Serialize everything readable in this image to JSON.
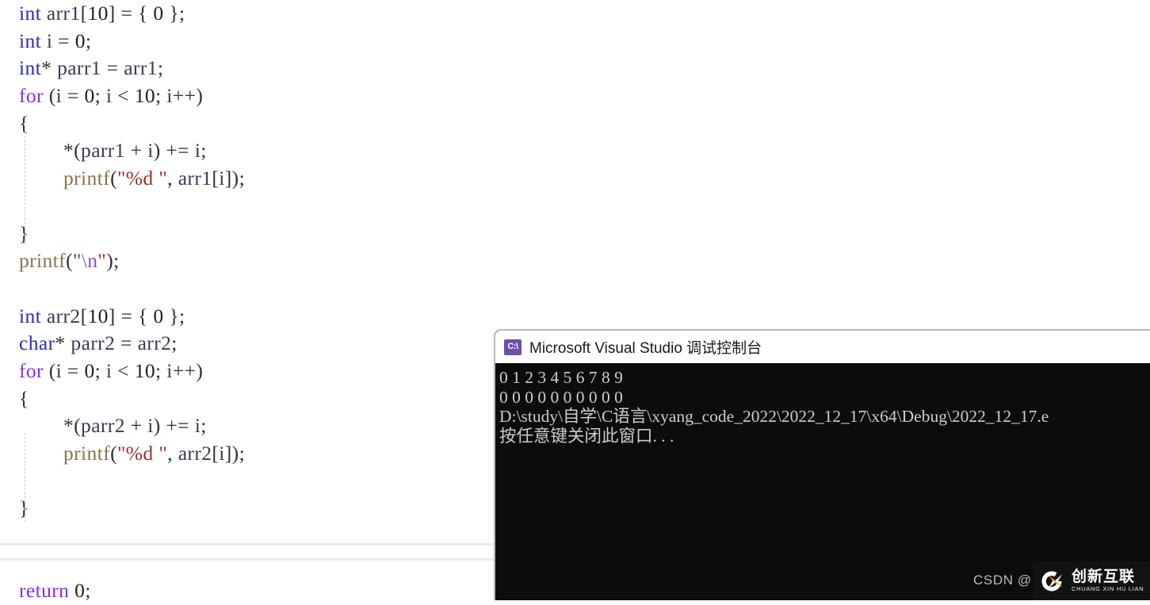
{
  "editor": {
    "lines": [
      {
        "id": 1,
        "indent": 0,
        "tokens": [
          {
            "t": "int",
            "c": "kw-type"
          },
          {
            "t": " ",
            "c": "plain"
          },
          {
            "t": "arr1",
            "c": "ident"
          },
          {
            "t": "[",
            "c": "punct"
          },
          {
            "t": "10",
            "c": "num"
          },
          {
            "t": "] = { ",
            "c": "punct"
          },
          {
            "t": "0",
            "c": "num"
          },
          {
            "t": " };",
            "c": "punct"
          }
        ]
      },
      {
        "id": 2,
        "indent": 0,
        "tokens": [
          {
            "t": "int",
            "c": "kw-type"
          },
          {
            "t": " ",
            "c": "plain"
          },
          {
            "t": "i",
            "c": "ident"
          },
          {
            "t": " = ",
            "c": "punct"
          },
          {
            "t": "0",
            "c": "num"
          },
          {
            "t": ";",
            "c": "punct"
          }
        ]
      },
      {
        "id": 3,
        "indent": 0,
        "tokens": [
          {
            "t": "int",
            "c": "kw-type"
          },
          {
            "t": "* ",
            "c": "punct"
          },
          {
            "t": "parr1",
            "c": "ident"
          },
          {
            "t": " = ",
            "c": "punct"
          },
          {
            "t": "arr1",
            "c": "ident"
          },
          {
            "t": ";",
            "c": "punct"
          }
        ]
      },
      {
        "id": 4,
        "indent": 0,
        "tokens": [
          {
            "t": "for",
            "c": "kw-ctrl"
          },
          {
            "t": " (",
            "c": "punct"
          },
          {
            "t": "i",
            "c": "ident"
          },
          {
            "t": " = ",
            "c": "punct"
          },
          {
            "t": "0",
            "c": "num"
          },
          {
            "t": "; ",
            "c": "punct"
          },
          {
            "t": "i",
            "c": "ident"
          },
          {
            "t": " < ",
            "c": "punct"
          },
          {
            "t": "10",
            "c": "num"
          },
          {
            "t": "; ",
            "c": "punct"
          },
          {
            "t": "i",
            "c": "ident"
          },
          {
            "t": "++)",
            "c": "punct"
          }
        ]
      },
      {
        "id": 5,
        "indent": 0,
        "tokens": [
          {
            "t": "{",
            "c": "brace"
          }
        ]
      },
      {
        "id": 6,
        "indent": 1,
        "tokens": [
          {
            "t": "*(",
            "c": "punct"
          },
          {
            "t": "parr1",
            "c": "ident"
          },
          {
            "t": " + ",
            "c": "punct"
          },
          {
            "t": "i",
            "c": "ident"
          },
          {
            "t": ") += ",
            "c": "punct"
          },
          {
            "t": "i",
            "c": "ident"
          },
          {
            "t": ";",
            "c": "punct"
          }
        ]
      },
      {
        "id": 7,
        "indent": 1,
        "tokens": [
          {
            "t": "printf",
            "c": "func"
          },
          {
            "t": "(",
            "c": "punct"
          },
          {
            "t": "\"%d \"",
            "c": "str"
          },
          {
            "t": ", ",
            "c": "punct"
          },
          {
            "t": "arr1",
            "c": "ident"
          },
          {
            "t": "[",
            "c": "punct"
          },
          {
            "t": "i",
            "c": "ident"
          },
          {
            "t": "]);",
            "c": "punct"
          }
        ]
      },
      {
        "id": 8,
        "indent": 1,
        "tokens": []
      },
      {
        "id": 9,
        "indent": 0,
        "tokens": [
          {
            "t": "}",
            "c": "brace"
          }
        ]
      },
      {
        "id": 10,
        "indent": 0,
        "tokens": [
          {
            "t": "printf",
            "c": "func"
          },
          {
            "t": "(",
            "c": "punct"
          },
          {
            "t": "\"",
            "c": "str"
          },
          {
            "t": "\\n",
            "c": "esc"
          },
          {
            "t": "\"",
            "c": "str"
          },
          {
            "t": ");",
            "c": "punct"
          }
        ]
      },
      {
        "id": 11,
        "indent": 0,
        "tokens": []
      },
      {
        "id": 12,
        "indent": 0,
        "tokens": [
          {
            "t": "int",
            "c": "kw-type"
          },
          {
            "t": " ",
            "c": "plain"
          },
          {
            "t": "arr2",
            "c": "ident"
          },
          {
            "t": "[",
            "c": "punct"
          },
          {
            "t": "10",
            "c": "num"
          },
          {
            "t": "] = { ",
            "c": "punct"
          },
          {
            "t": "0",
            "c": "num"
          },
          {
            "t": " };",
            "c": "punct"
          }
        ]
      },
      {
        "id": 13,
        "indent": 0,
        "tokens": [
          {
            "t": "char",
            "c": "kw-type"
          },
          {
            "t": "* ",
            "c": "punct"
          },
          {
            "t": "parr2",
            "c": "ident"
          },
          {
            "t": " = ",
            "c": "punct"
          },
          {
            "t": "arr2",
            "c": "ident"
          },
          {
            "t": ";",
            "c": "punct"
          }
        ]
      },
      {
        "id": 14,
        "indent": 0,
        "tokens": [
          {
            "t": "for",
            "c": "kw-ctrl"
          },
          {
            "t": " (",
            "c": "punct"
          },
          {
            "t": "i",
            "c": "ident"
          },
          {
            "t": " = ",
            "c": "punct"
          },
          {
            "t": "0",
            "c": "num"
          },
          {
            "t": "; ",
            "c": "punct"
          },
          {
            "t": "i",
            "c": "ident"
          },
          {
            "t": " < ",
            "c": "punct"
          },
          {
            "t": "10",
            "c": "num"
          },
          {
            "t": "; ",
            "c": "punct"
          },
          {
            "t": "i",
            "c": "ident"
          },
          {
            "t": "++)",
            "c": "punct"
          }
        ]
      },
      {
        "id": 15,
        "indent": 0,
        "tokens": [
          {
            "t": "{",
            "c": "brace"
          }
        ]
      },
      {
        "id": 16,
        "indent": 1,
        "tokens": [
          {
            "t": "*(",
            "c": "punct"
          },
          {
            "t": "parr2",
            "c": "ident"
          },
          {
            "t": " + ",
            "c": "punct"
          },
          {
            "t": "i",
            "c": "ident"
          },
          {
            "t": ") += ",
            "c": "punct"
          },
          {
            "t": "i",
            "c": "ident"
          },
          {
            "t": ";",
            "c": "punct"
          }
        ]
      },
      {
        "id": 17,
        "indent": 1,
        "tokens": [
          {
            "t": "printf",
            "c": "func"
          },
          {
            "t": "(",
            "c": "punct"
          },
          {
            "t": "\"%d \"",
            "c": "str"
          },
          {
            "t": ", ",
            "c": "punct"
          },
          {
            "t": "arr2",
            "c": "ident"
          },
          {
            "t": "[",
            "c": "punct"
          },
          {
            "t": "i",
            "c": "ident"
          },
          {
            "t": "]);",
            "c": "punct"
          }
        ]
      },
      {
        "id": 18,
        "indent": 1,
        "tokens": []
      },
      {
        "id": 19,
        "indent": 0,
        "tokens": [
          {
            "t": "}",
            "c": "brace"
          }
        ]
      },
      {
        "id": 20,
        "indent": 0,
        "tokens": []
      },
      {
        "id": 21,
        "indent": 0,
        "tokens": []
      },
      {
        "id": 22,
        "indent": 0,
        "tokens": [
          {
            "t": "return",
            "c": "kw-ret"
          },
          {
            "t": " ",
            "c": "plain"
          },
          {
            "t": "0",
            "c": "num"
          },
          {
            "t": ";",
            "c": "punct"
          }
        ]
      }
    ],
    "plain_text": [
      "int arr1[10] = { 0 };",
      "int i = 0;",
      "int* parr1 = arr1;",
      "for (i = 0; i < 10; i++)",
      "{",
      "    *(parr1 + i) += i;",
      "    printf(\"%d \", arr1[i]);",
      "",
      "}",
      "printf(\"\\n\");",
      "",
      "int arr2[10] = { 0 };",
      "char* parr2 = arr2;",
      "for (i = 0; i < 10; i++)",
      "{",
      "    *(parr2 + i) += i;",
      "    printf(\"%d \", arr2[i]);",
      "",
      "}",
      "",
      "",
      "return 0;"
    ],
    "colors": {
      "background": "#ffffff",
      "type_keyword": "#2b2bbf",
      "control_keyword": "#8a2be2",
      "identifier": "#3a3a58",
      "function": "#8a7248",
      "string": "#a02b2b",
      "escape": "#8f4fd8",
      "punctuation": "#303030",
      "indent_guide": "#c9c9c9",
      "separator": "#e9eaee"
    }
  },
  "console": {
    "title": "Microsoft Visual Studio 调试控制台",
    "icon_label": "C:\\",
    "icon_color": "#6b4fa8",
    "titlebar_background": "#ffffff",
    "body_background": "#0c0c0c",
    "text_color": "#cccccc",
    "border_color": "#b9b9bd",
    "output_lines": [
      "0 1 2 3 4 5 6 7 8 9",
      "0 0 0 0 0 0 0 0 0 0",
      "D:\\study\\自学\\C语言\\xyang_code_2022\\2022_12_17\\x64\\Debug\\2022_12_17.e",
      "按任意键关闭此窗口. . ."
    ]
  },
  "watermark": {
    "csdn_label": "CSDN @",
    "logo_cn": "创新互联",
    "logo_en": "CHUANG XIN HU LIAN",
    "logo_background": "#121212",
    "logo_accent": "#f0b323",
    "text_color": "#b9b9b9"
  }
}
